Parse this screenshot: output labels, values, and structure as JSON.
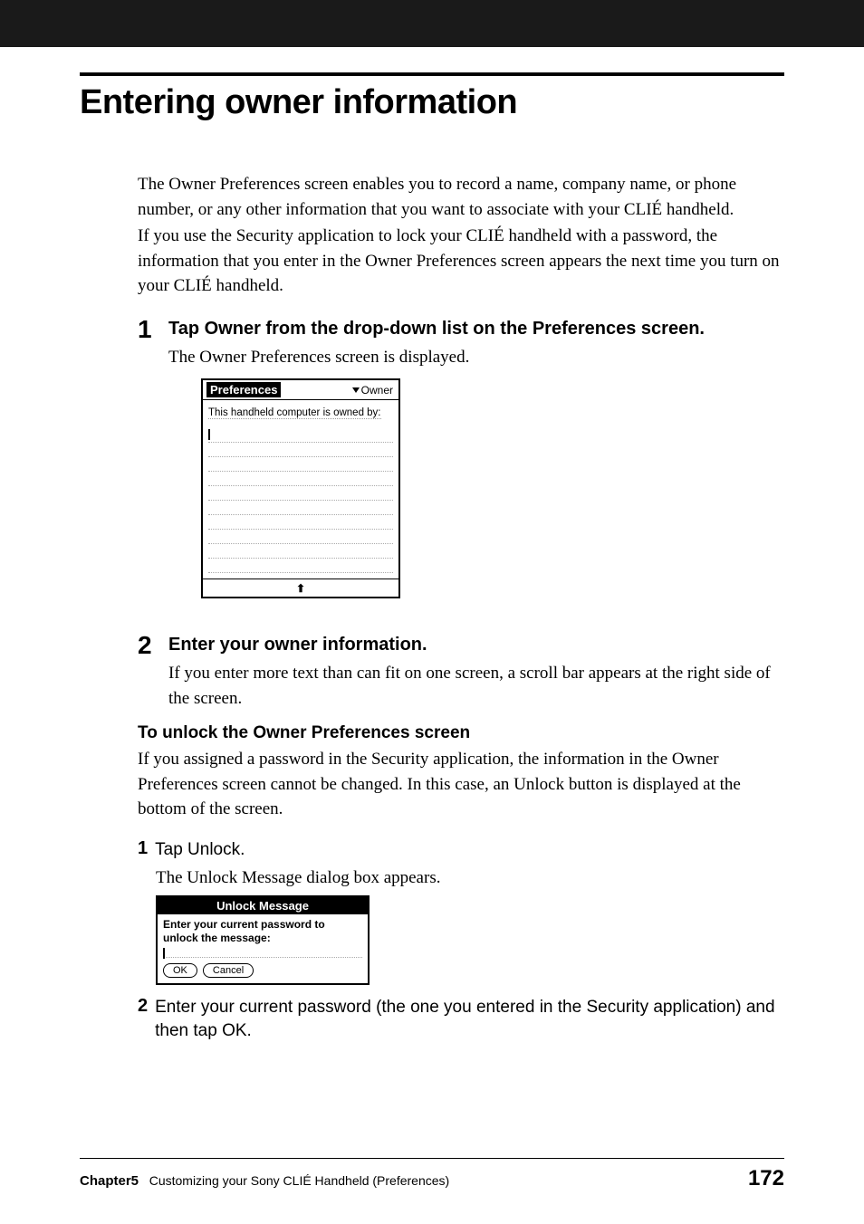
{
  "title": "Entering owner information",
  "intro": {
    "p1": "The Owner Preferences screen enables you to record a name, company name, or phone number, or any other information that you want to associate with your CLIÉ handheld.",
    "p2": "If you use the Security application to lock your CLIÉ handheld with a password, the information that you enter in the Owner Preferences screen appears the next time you turn on your CLIÉ handheld."
  },
  "steps": [
    {
      "num": "1",
      "heading": "Tap Owner from the drop-down list on the Preferences screen.",
      "body": "The Owner Preferences screen is displayed."
    },
    {
      "num": "2",
      "heading": "Enter your owner information.",
      "body": "If you enter more text than can fit on one screen, a scroll bar appears at the right side of the screen."
    }
  ],
  "prefs_screenshot": {
    "title": "Preferences",
    "dropdown": "Owner",
    "owned_by": "This handheld computer is owned by:"
  },
  "unlock_section": {
    "heading": "To unlock the Owner Preferences screen",
    "body": "If you assigned a password in the Security application, the information in the Owner Preferences screen cannot be changed. In this case, an Unlock button is displayed at the bottom of the screen."
  },
  "substeps": [
    {
      "num": "1",
      "heading": "Tap Unlock.",
      "body": "The Unlock Message dialog box appears."
    },
    {
      "num": "2",
      "heading": "Enter your current password (the one you entered in the Security application) and then tap OK."
    }
  ],
  "unlock_dialog": {
    "title": "Unlock Message",
    "prompt": "Enter your current password to unlock the message:",
    "ok": "OK",
    "cancel": "Cancel"
  },
  "footer": {
    "chapter": "Chapter5",
    "subtitle": "Customizing your Sony CLIÉ Handheld (Preferences)",
    "page": "172"
  }
}
